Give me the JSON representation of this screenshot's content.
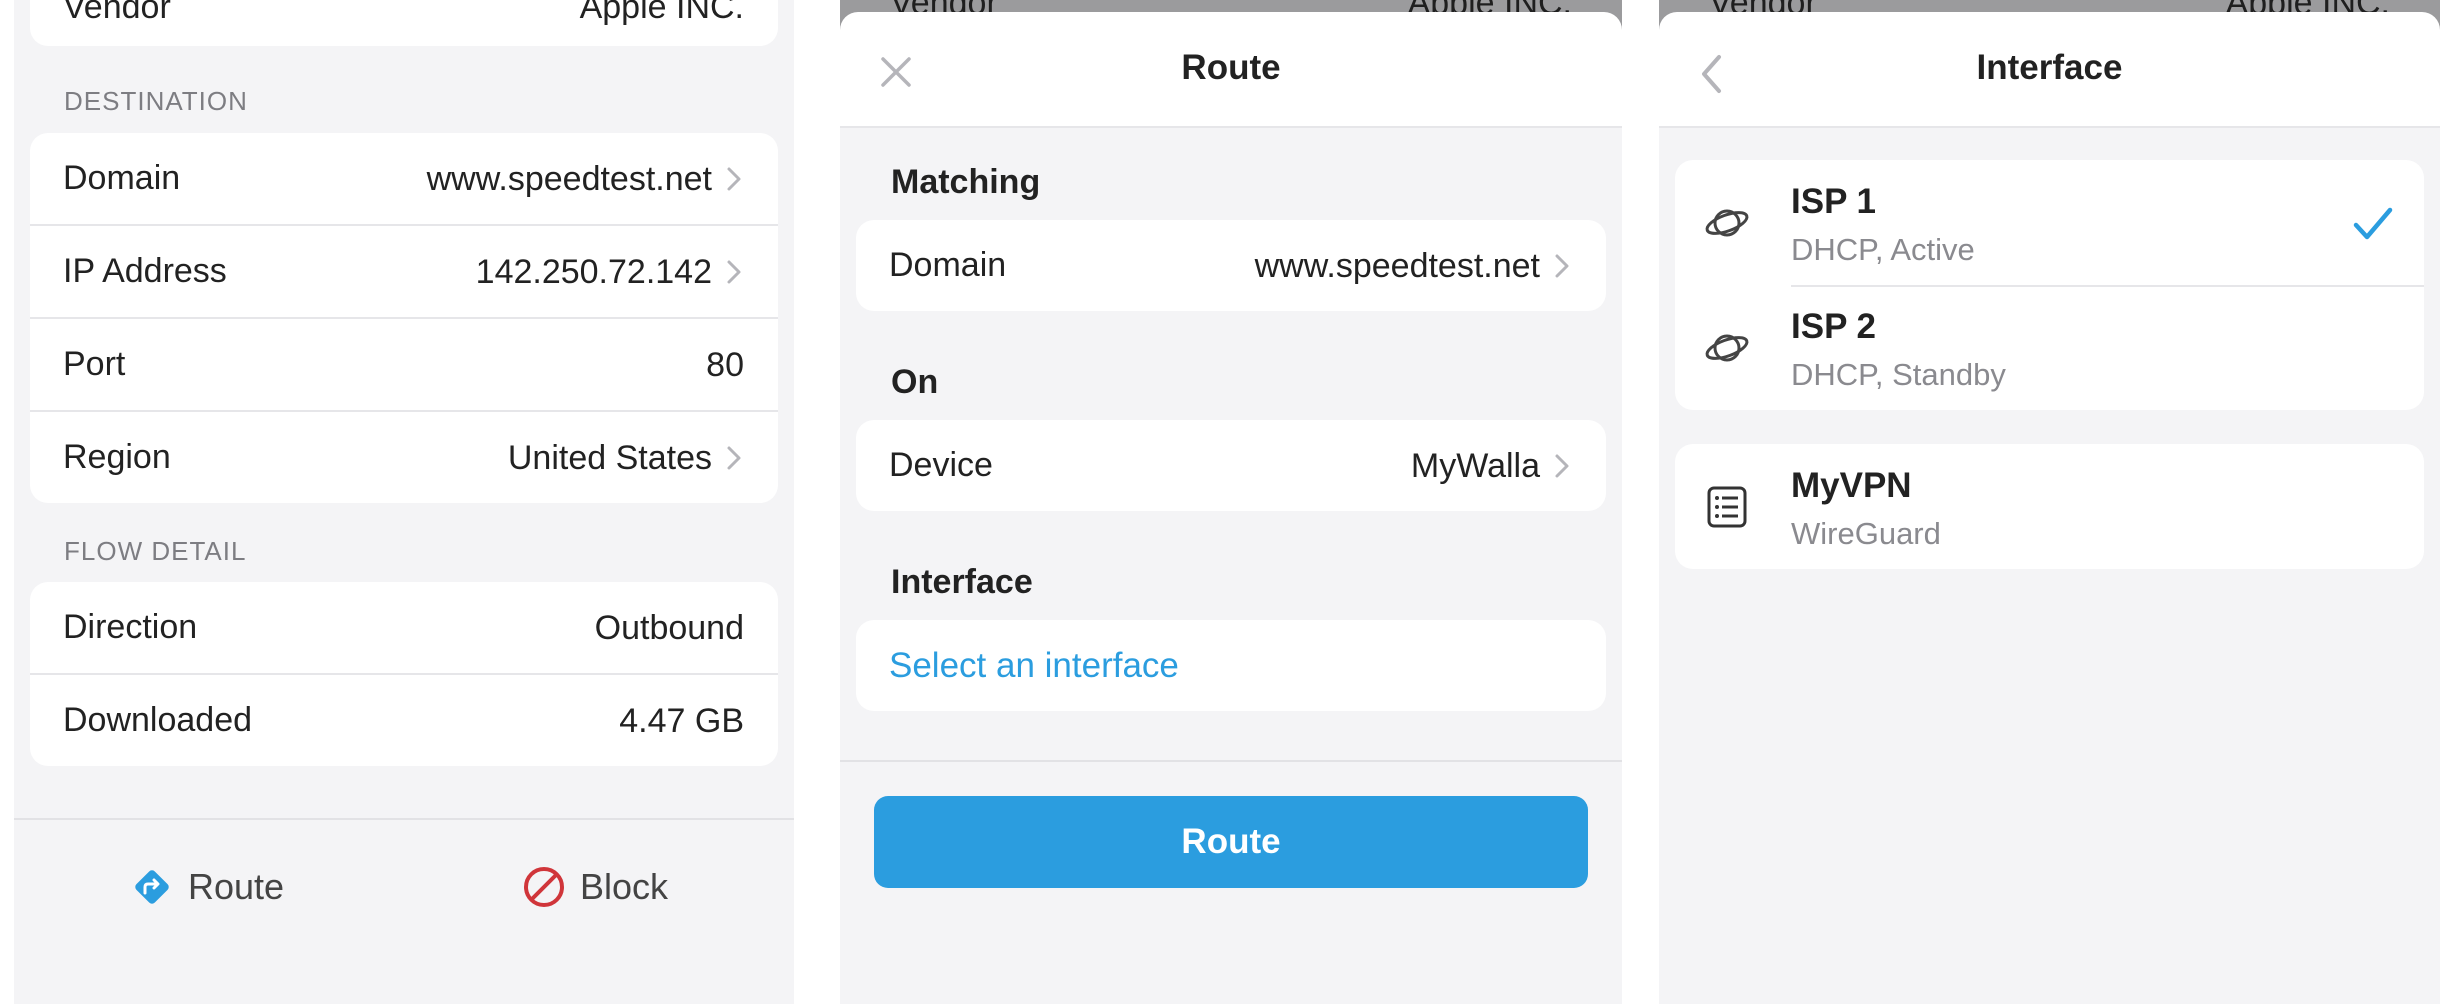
{
  "panel1": {
    "vendor": {
      "label": "Vendor",
      "value": "Apple INC."
    },
    "destination_title": "DESTINATION",
    "destination_rows": [
      {
        "label": "Domain",
        "value": "www.speedtest.net",
        "chevron": true
      },
      {
        "label": "IP Address",
        "value": "142.250.72.142",
        "chevron": true
      },
      {
        "label": "Port",
        "value": "80",
        "chevron": false
      },
      {
        "label": "Region",
        "value": "United States",
        "chevron": true
      }
    ],
    "flow_title": "FLOW DETAIL",
    "flow_rows": [
      {
        "label": "Direction",
        "value": "Outbound"
      },
      {
        "label": "Downloaded",
        "value": "4.47 GB"
      }
    ],
    "actions": {
      "route_label": "Route",
      "block_label": "Block"
    }
  },
  "panel2": {
    "behind": {
      "label": "Vendor",
      "value": "Apple INC."
    },
    "title": "Route",
    "matching_title": "Matching",
    "matching_row": {
      "label": "Domain",
      "value": "www.speedtest.net"
    },
    "on_title": "On",
    "device_row": {
      "label": "Device",
      "value": "MyWalla"
    },
    "interface_title": "Interface",
    "interface_placeholder": "Select an interface",
    "button_label": "Route"
  },
  "panel3": {
    "behind": {
      "label": "Vendor",
      "value": "Apple INC."
    },
    "title": "Interface",
    "isp_group": [
      {
        "name": "ISP 1",
        "sub": "DHCP, Active",
        "selected": true,
        "icon": "planet-icon"
      },
      {
        "name": "ISP 2",
        "sub": "DHCP, Standby",
        "selected": false,
        "icon": "planet-icon"
      }
    ],
    "vpn_group": [
      {
        "name": "MyVPN",
        "sub": "WireGuard",
        "icon": "list-icon"
      }
    ]
  },
  "colors": {
    "accent": "#2b9ddf",
    "block": "#d0353a",
    "background": "#f4f4f6"
  }
}
